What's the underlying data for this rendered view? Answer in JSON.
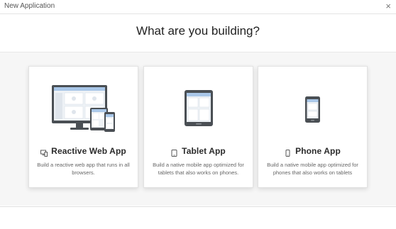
{
  "window": {
    "title": "New Application",
    "close_glyph": "×"
  },
  "heading": "What are you building?",
  "cards": [
    {
      "label": "Reactive Web App",
      "description": "Build a reactive web app that runs in all browsers.",
      "icon": "desktop-devices-icon",
      "small_icon": "multi-device-icon"
    },
    {
      "label": "Tablet App",
      "description": "Build a native mobile app optimized for tablets that also works on phones.",
      "icon": "tablet-icon",
      "small_icon": "tablet-small-icon"
    },
    {
      "label": "Phone App",
      "description": "Build a native mobile app optimized for phones that also works on tablets",
      "icon": "phone-icon",
      "small_icon": "phone-small-icon"
    }
  ],
  "colors": {
    "device_frame": "#4a4f54",
    "screen_bg": "#eef2f6",
    "screen_header": "#a9c7e8",
    "panel_bg": "#f6f6f6"
  }
}
